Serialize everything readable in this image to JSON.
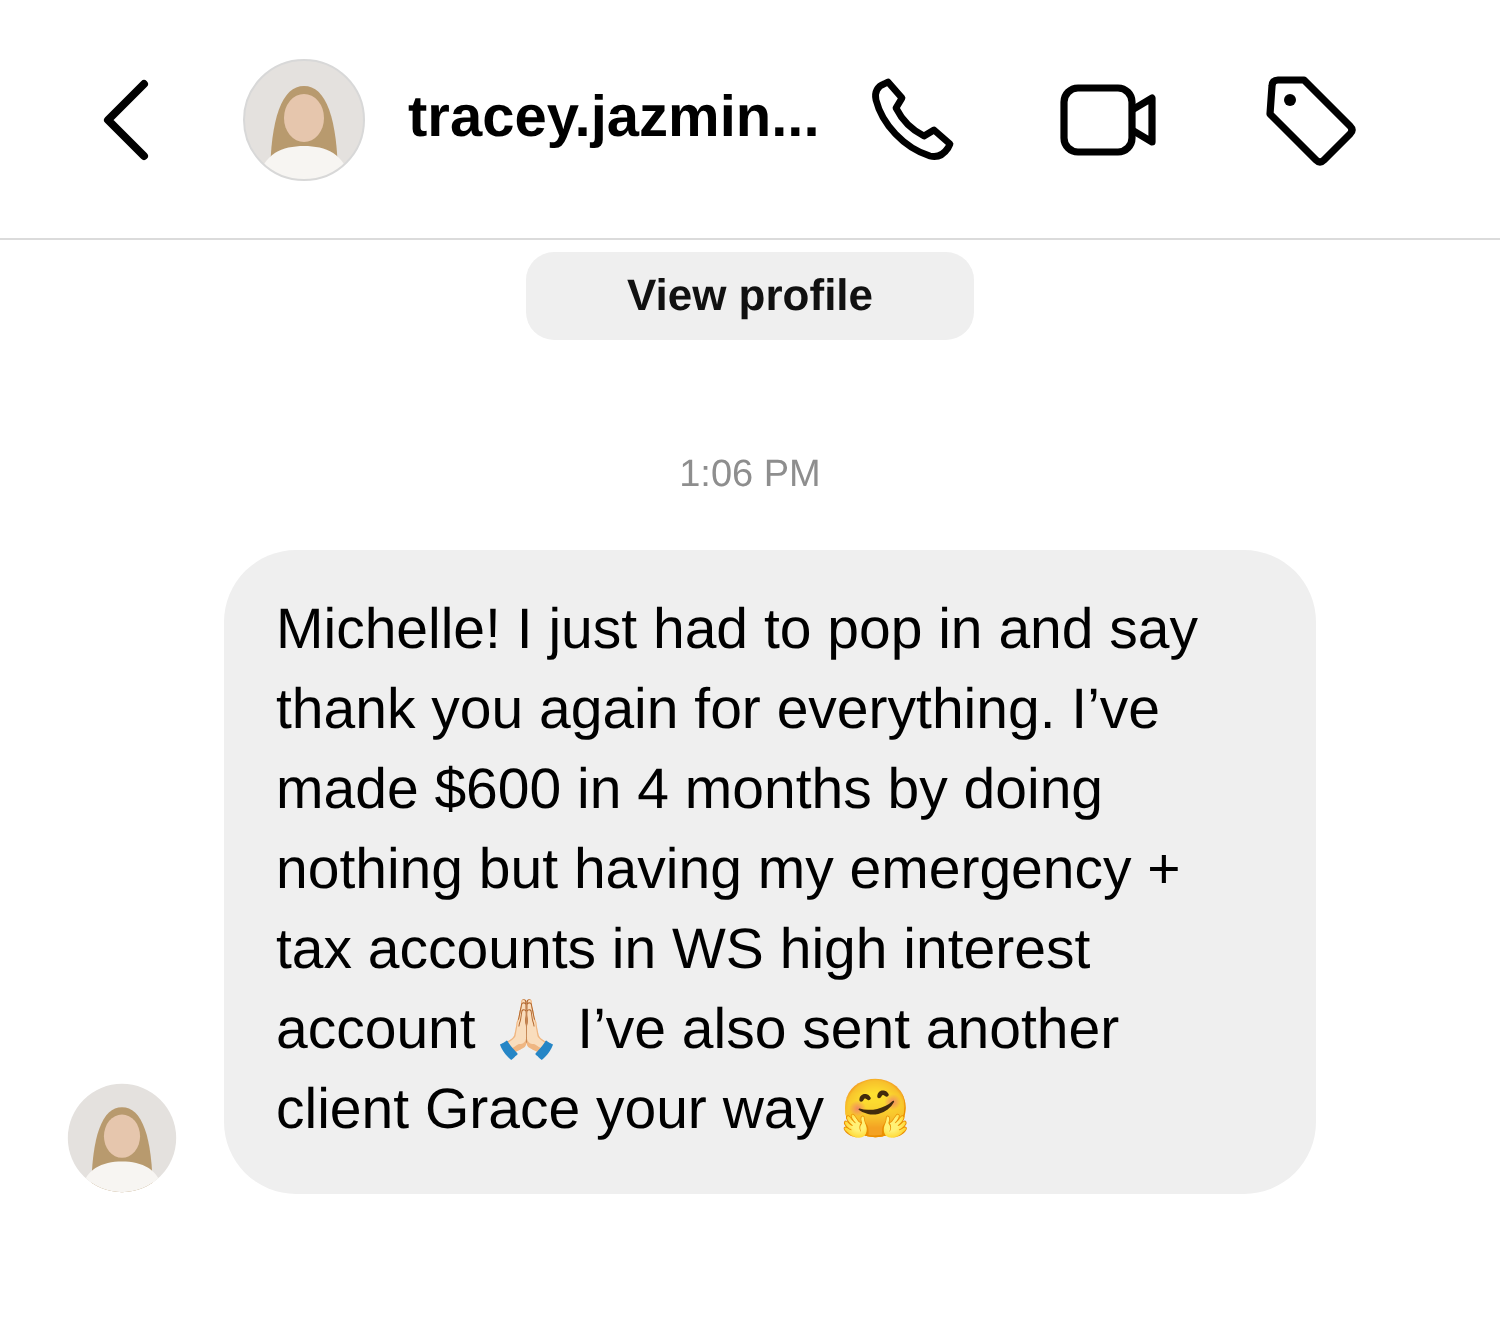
{
  "header": {
    "username": "tracey.jazmin..."
  },
  "profile_button": {
    "label": "View profile"
  },
  "timestamp": "1:06 PM",
  "messages": [
    {
      "text": "Michelle! I just had to pop in and say thank you again for everything. I’ve made $600 in 4 months by doing nothing but having my emergency + tax accounts in WS high interest account 🙏🏻 I’ve also sent another client Grace your way 🤗"
    }
  ]
}
